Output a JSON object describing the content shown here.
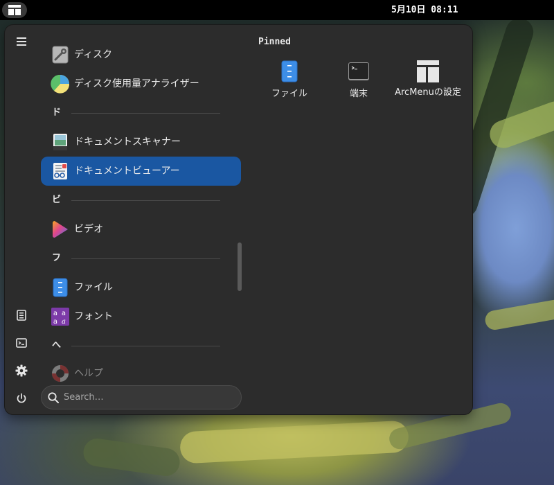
{
  "topbar": {
    "clock": "5月10日  08:11",
    "activities_icon": "arcmenu-layout-icon"
  },
  "menu": {
    "sidebar": [
      {
        "name": "hamburger-menu-icon"
      },
      {
        "name": "document-viewer-icon"
      },
      {
        "name": "terminal-icon"
      },
      {
        "name": "gear-icon"
      },
      {
        "name": "power-icon"
      }
    ],
    "apps": [
      {
        "kind": "app",
        "label": "ディスク",
        "icon": "disk-utility-icon"
      },
      {
        "kind": "app",
        "label": "ディスク使用量アナライザー",
        "icon": "disk-usage-analyzer-icon"
      },
      {
        "kind": "section",
        "label": "ド"
      },
      {
        "kind": "app",
        "label": "ドキュメントスキャナー",
        "icon": "document-scanner-icon"
      },
      {
        "kind": "app",
        "label": "ドキュメントビューアー",
        "icon": "document-viewer-icon",
        "selected": true
      },
      {
        "kind": "section",
        "label": "ビ"
      },
      {
        "kind": "app",
        "label": "ビデオ",
        "icon": "video-player-icon"
      },
      {
        "kind": "section",
        "label": "フ"
      },
      {
        "kind": "app",
        "label": "ファイル",
        "icon": "files-icon"
      },
      {
        "kind": "app",
        "label": "フォント",
        "icon": "fonts-icon"
      },
      {
        "kind": "section",
        "label": "へ"
      },
      {
        "kind": "app",
        "label": "ヘルプ",
        "icon": "help-lifebuoy-icon",
        "faded": true
      }
    ],
    "search": {
      "placeholder": "Search…",
      "value": ""
    },
    "pinned": {
      "title": "Pinned",
      "items": [
        {
          "label": "ファイル",
          "icon": "files-icon"
        },
        {
          "label": "端末",
          "icon": "terminal-icon"
        },
        {
          "label": "ArcMenuの設定",
          "icon": "arcmenu-settings-icon"
        }
      ]
    }
  },
  "colors": {
    "selected": "#1a57a2",
    "menu_bg": "#2c2c2c",
    "topbar_bg": "#000000"
  }
}
